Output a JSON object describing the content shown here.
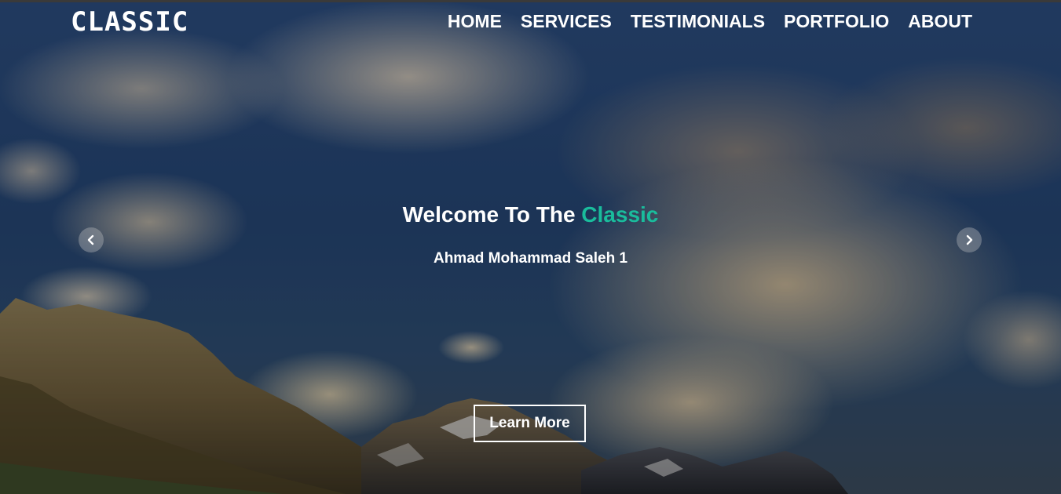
{
  "navbar": {
    "brand": "CLASSIC",
    "links": [
      {
        "label": "HOME"
      },
      {
        "label": "SERVICES"
      },
      {
        "label": "TESTIMONIALS"
      },
      {
        "label": "PORTFOLIO"
      },
      {
        "label": "ABOUT"
      }
    ]
  },
  "hero": {
    "heading_prefix": "Welcome To The ",
    "heading_accent": "Classic",
    "subtitle": "Ahmad Mohammad Saleh 1",
    "cta_label": "Learn More",
    "prev_icon": "chevron-left-icon",
    "next_icon": "chevron-right-icon"
  },
  "colors": {
    "accent": "#1abc9c",
    "text": "#ffffff"
  }
}
